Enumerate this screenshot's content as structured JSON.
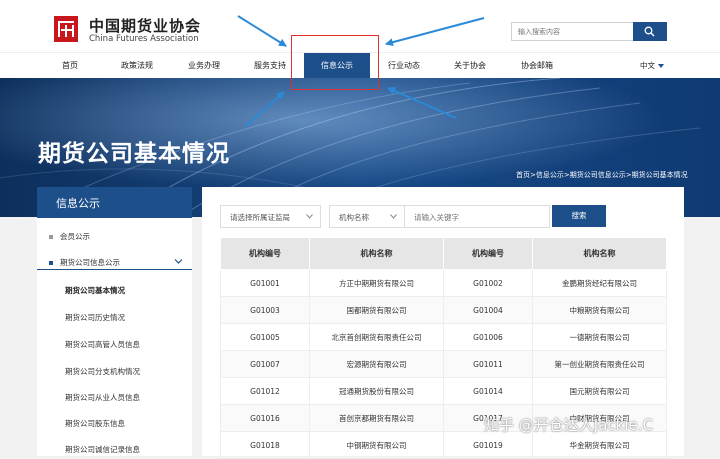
{
  "header": {
    "logo_cn": "中国期货业协会",
    "logo_en": "China Futures Association",
    "search_placeholder": "输入搜索内容"
  },
  "nav": {
    "items": [
      "首页",
      "政策法规",
      "业务办理",
      "服务支持",
      "信息公示",
      "行业动态",
      "关于协会",
      "协会邮箱"
    ],
    "active": "信息公示",
    "lang": "中文"
  },
  "banner": {
    "title": "期货公司基本情况",
    "breadcrumb": "首页>信息公示>期货公司信息公示>期货公司基本情况"
  },
  "sidebar": {
    "title": "信息公示",
    "items": [
      {
        "label": "会员公示"
      },
      {
        "label": "期货公司信息公示"
      }
    ],
    "subitems": [
      "期货公司基本情况",
      "期货公司历史情况",
      "期货公司高管人员信息",
      "期货公司分支机构情况",
      "期货公司从业人员信息",
      "期货公司股东信息",
      "期货公司诚信记录信息"
    ]
  },
  "filters": {
    "regulator_placeholder": "请选择所属证监局",
    "field_select": "机构名称",
    "keyword_placeholder": "请输入关键字",
    "search_button": "搜索"
  },
  "table": {
    "headers": [
      "机构编号",
      "机构名称",
      "机构编号",
      "机构名称"
    ],
    "rows": [
      [
        "G01001",
        "方正中期期货有限公司",
        "G01002",
        "金鹏期货经纪有限公司"
      ],
      [
        "G01003",
        "国都期货有限公司",
        "G01004",
        "中粮期货有限公司"
      ],
      [
        "G01005",
        "北京首创期货有限责任公司",
        "G01006",
        "一德期货有限公司"
      ],
      [
        "G01007",
        "宏源期货有限公司",
        "G01011",
        "第一创业期货有限责任公司"
      ],
      [
        "G01012",
        "冠通期货股份有限公司",
        "G01014",
        "国元期货有限公司"
      ],
      [
        "G01016",
        "首创京都期货有限公司",
        "G01017",
        "中财期货有限公司"
      ],
      [
        "G01018",
        "中钢期货有限公司",
        "G01019",
        "华金期货有限公司"
      ]
    ]
  },
  "watermark": "知乎 @开仓达人Jackie.C",
  "colors": {
    "brand_blue": "#1d4f8b",
    "logo_red": "#c8161d",
    "annotation_red": "#e03030",
    "arrow_blue": "#2a8ad8"
  }
}
